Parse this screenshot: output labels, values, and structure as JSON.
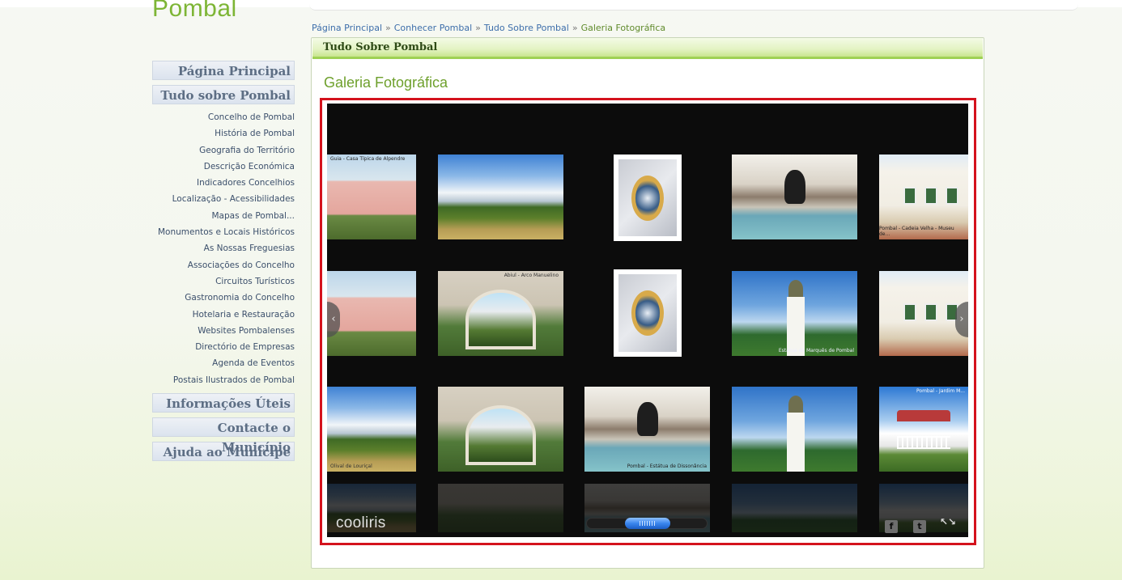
{
  "site": {
    "logo_text": "Pombal"
  },
  "breadcrumb": {
    "items": [
      "Página Principal",
      "Conhecer Pombal",
      "Tudo Sobre Pombal"
    ],
    "separator": "»",
    "current": "Galeria Fotográfica"
  },
  "sidebar": {
    "main_items": [
      {
        "label": "Página Principal"
      },
      {
        "label": "Tudo sobre Pombal"
      },
      {
        "label": "Informações Úteis"
      },
      {
        "label": "Contacte o Município"
      },
      {
        "label": "Ajuda ao Munícipe"
      }
    ],
    "sub_items": [
      "Concelho de Pombal",
      "História de Pombal",
      "Geografia do Território",
      "Descrição Económica",
      "Indicadores Concelhios",
      "Localização - Acessibilidades",
      "Mapas de Pombal...",
      "Monumentos e Locais Históricos",
      "As Nossas Freguesias",
      "Associações do Concelho",
      "Circuitos Turísticos",
      "Gastronomia do Concelho",
      "Hotelaria e Restauração",
      "Websites Pombalenses",
      "Directório de Empresas",
      "Agenda de Eventos",
      "Postais Ilustrados de Pombal"
    ]
  },
  "main": {
    "panel_header": "Tudo Sobre Pombal",
    "page_title": "Galeria Fotográfica"
  },
  "gallery": {
    "brand": "cooliris",
    "nav_prev_icon": "‹",
    "nav_next_icon": "›",
    "share_facebook_glyph": "f",
    "share_twitter_glyph": "t",
    "fullscreen_glyph": "↖↘",
    "thumb_captions": {
      "house": "Guia - Casa Típica de Alpendre",
      "arch": "Abiul - Arco Manuelino",
      "building": "Pombal - Cadeia Velha - Museu de...",
      "statue": "Pombal - Estátua de Dissonância",
      "monument": "Estátua do Marquês de Pombal",
      "olive": "Olival de Louriçal",
      "kiosk": "Pombal - Jardim M..."
    },
    "accent_color": "#d4121d"
  },
  "colors": {
    "brand_green": "#7db535",
    "link_blue": "#3d6eaa",
    "panel_border": "#9fd154"
  }
}
